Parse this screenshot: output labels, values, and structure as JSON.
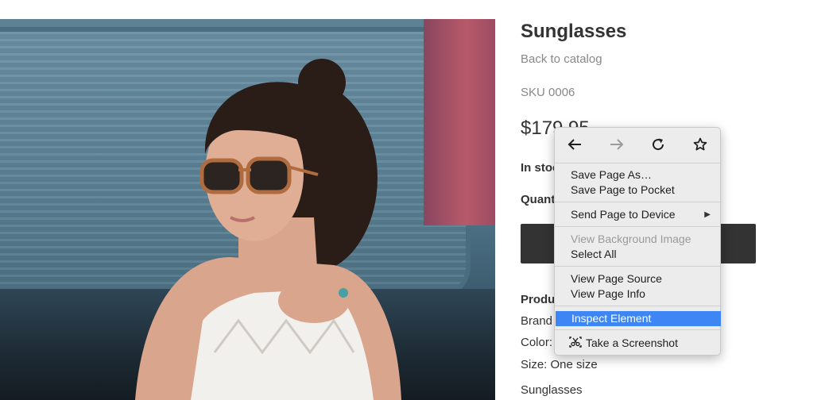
{
  "product": {
    "title": "Sunglasses",
    "back_link": "Back to catalog",
    "sku": "SKU 0006",
    "price": "$179.95",
    "stock": "In stock",
    "quantity_label": "Quantity",
    "add_to_cart": "",
    "details_heading": "Product details",
    "brand": "Brand",
    "color": "Color:",
    "size": "Size: One size",
    "description": "Sunglasses"
  },
  "context_menu": {
    "nav": {
      "back_icon": "arrow-left-icon",
      "forward_icon": "arrow-right-icon",
      "reload_icon": "reload-icon",
      "bookmark_icon": "star-icon"
    },
    "items": [
      {
        "label": "Save Page As…",
        "enabled": true
      },
      {
        "label": "Save Page to Pocket",
        "enabled": true
      },
      {
        "label": "Send Page to Device",
        "enabled": true,
        "submenu": true
      },
      {
        "label": "View Background Image",
        "enabled": false
      },
      {
        "label": "Select All",
        "enabled": true
      },
      {
        "label": "View Page Source",
        "enabled": true
      },
      {
        "label": "View Page Info",
        "enabled": true
      },
      {
        "label": "Inspect Element",
        "enabled": true,
        "highlighted": true
      },
      {
        "label": "Take a Screenshot",
        "enabled": true,
        "icon": "screenshot-icon"
      }
    ],
    "submenu_arrow": "▶"
  },
  "colors": {
    "highlight": "#3d86f4",
    "button": "#333333",
    "muted_text": "#888888"
  }
}
